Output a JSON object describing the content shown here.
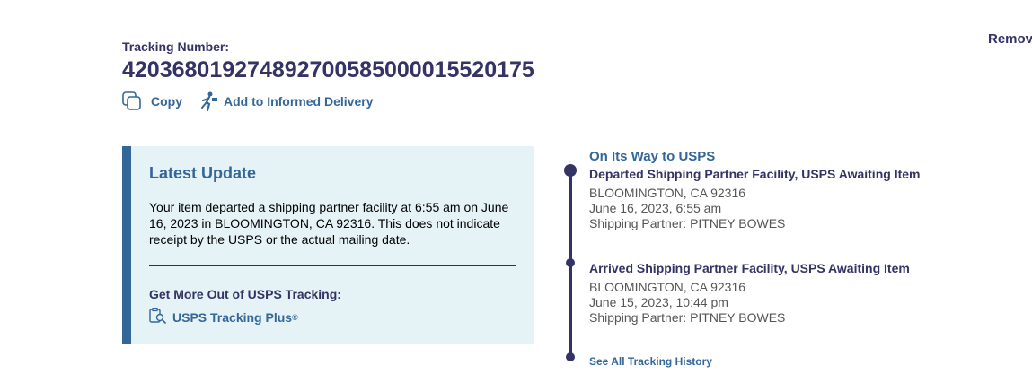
{
  "header": {
    "remove_label": "Remov",
    "tracking_label": "Tracking Number:",
    "tracking_number": "420368019274892700585000015520175",
    "copy_label": "Copy",
    "informed_delivery_label": "Add to Informed Delivery"
  },
  "latest_update": {
    "title": "Latest Update",
    "message": "Your item departed a shipping partner facility at 6:55 am on June 16, 2023 in BLOOMINGTON, CA 92316. This does not indicate receipt by the USPS or the actual mailing date.",
    "more_label": "Get More Out of USPS Tracking:",
    "plus_label": "USPS Tracking Plus",
    "plus_mark": "®"
  },
  "timeline": {
    "status": "On Its Way to USPS",
    "events": [
      {
        "title": "Departed Shipping Partner Facility, USPS Awaiting Item",
        "location": "BLOOMINGTON, CA 92316",
        "datetime": "June 16, 2023, 6:55 am",
        "partner": "Shipping Partner: PITNEY BOWES"
      },
      {
        "title": "Arrived Shipping Partner Facility, USPS Awaiting Item",
        "location": "BLOOMINGTON, CA 92316",
        "datetime": "June 15, 2023, 10:44 pm",
        "partner": "Shipping Partner: PITNEY BOWES"
      }
    ],
    "see_all_label": "See All Tracking History"
  },
  "colors": {
    "navy": "#333366",
    "link_blue": "#336699",
    "panel_bg": "#e6f3f6"
  },
  "icons": [
    "copy-icon",
    "informed-delivery-icon",
    "tracking-plus-icon"
  ]
}
